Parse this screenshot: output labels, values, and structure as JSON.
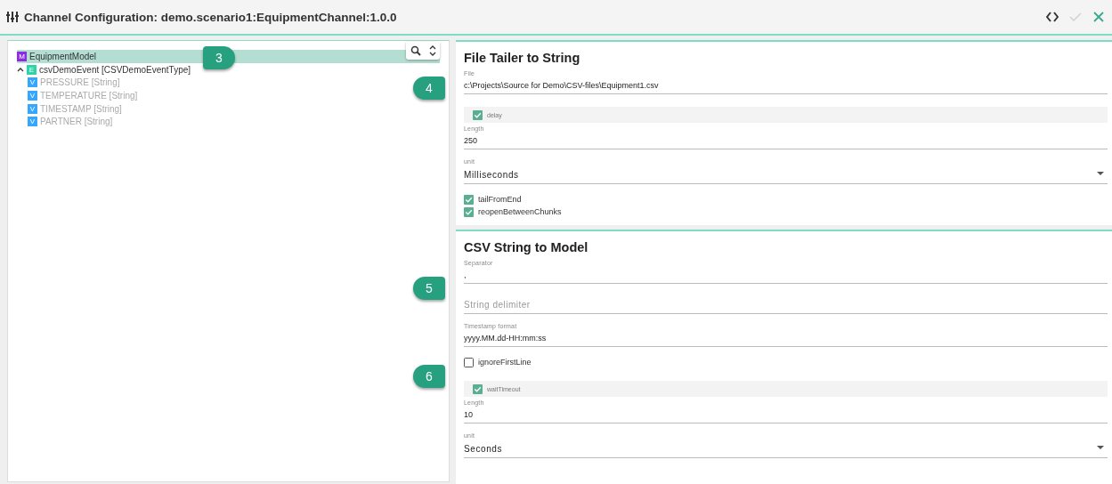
{
  "header": {
    "title": "Channel Configuration: demo.scenario1:EquipmentChannel:1.0.0",
    "actions": [
      {
        "kind": "code",
        "disabled": false
      },
      {
        "kind": "confirm",
        "disabled": true
      },
      {
        "kind": "close",
        "disabled": false
      }
    ]
  },
  "tree": {
    "items": [
      {
        "badge": "M",
        "kind": "model",
        "label": "EquipmentModel",
        "selected": true,
        "disabled": false
      },
      {
        "badge": "E",
        "kind": "event",
        "label": "csvDemoEvent [CSVDemoEventType]",
        "selected": false,
        "expanded": true,
        "disabled": false,
        "children": [
          {
            "badge": "V",
            "kind": "value",
            "label": "PRESSURE [String]",
            "selected": false,
            "disabled": true
          },
          {
            "badge": "V",
            "kind": "value",
            "label": "TEMPERATURE [String]",
            "selected": false,
            "disabled": true
          },
          {
            "badge": "V",
            "kind": "value",
            "label": "TIMESTAMP [String]",
            "selected": false,
            "disabled": true
          },
          {
            "badge": "V",
            "kind": "value",
            "label": "PARTNER [String]",
            "selected": false,
            "disabled": true
          }
        ]
      }
    ]
  },
  "panels": [
    {
      "title": "File Tailer to String",
      "fields": [
        {
          "kind": "text",
          "label": "File",
          "value": "c:\\Projects\\Source for Demo\\CSV-files\\Equipment1.csv"
        },
        {
          "kind": "group",
          "label": "delay",
          "checked": true
        },
        {
          "kind": "text",
          "label": "Length",
          "value": "250"
        },
        {
          "kind": "select",
          "label": "unit",
          "value": "Milliseconds"
        },
        {
          "kind": "checkbox",
          "label": "tailFromEnd",
          "checked": true
        },
        {
          "kind": "checkbox",
          "label": "reopenBetweenChunks",
          "checked": true
        }
      ]
    },
    {
      "title": "CSV String to Model",
      "fields": [
        {
          "kind": "text",
          "label": "Separator",
          "value": ","
        },
        {
          "kind": "text",
          "placeholder": "String delimiter"
        },
        {
          "kind": "text",
          "label": "Timestamp format",
          "value": "yyyy.MM.dd-HH:mm:ss"
        },
        {
          "kind": "checkbox",
          "label": "ignoreFirstLine",
          "checked": false
        },
        {
          "kind": "group",
          "label": "waitTimeout",
          "checked": true
        },
        {
          "kind": "text",
          "label": "Length",
          "value": "10"
        },
        {
          "kind": "select",
          "label": "unit",
          "value": "Seconds"
        }
      ]
    }
  ],
  "callouts": [
    {
      "number": "3"
    },
    {
      "number": "4"
    },
    {
      "number": "5"
    },
    {
      "number": "6"
    }
  ]
}
